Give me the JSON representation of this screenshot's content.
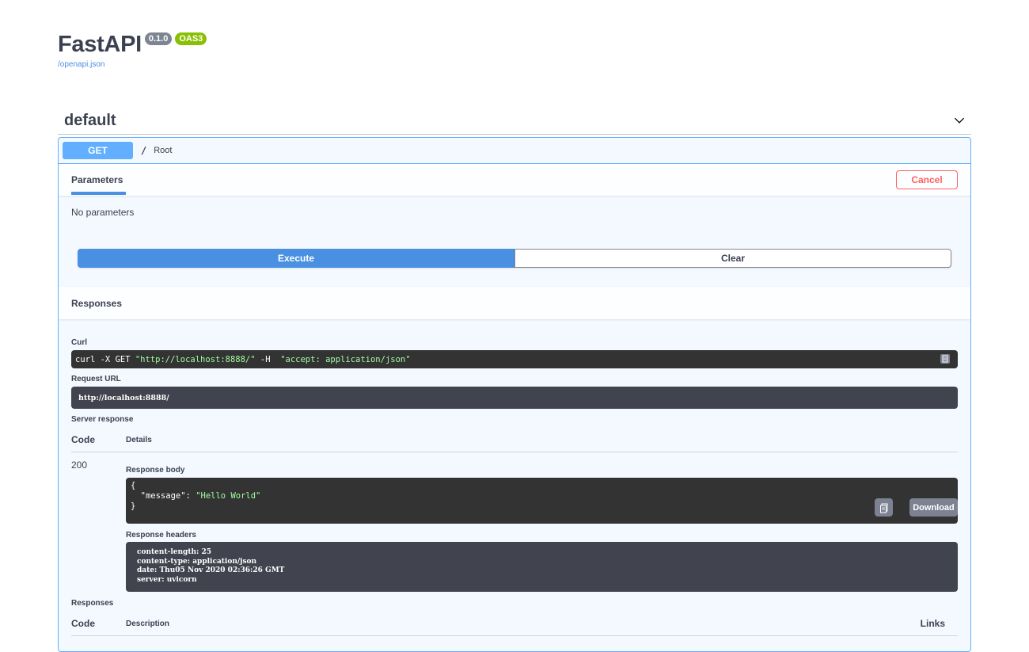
{
  "info": {
    "title": "FastAPI",
    "version": "0.1.0",
    "oas_badge": "OAS3",
    "spec_link": "/openapi.json"
  },
  "tag": {
    "name": "default",
    "toggle_icon": "chevron-down-icon"
  },
  "operation": {
    "method": "GET",
    "path": "/",
    "summary": "Root",
    "parameters_tab": "Parameters",
    "cancel_label": "Cancel",
    "no_params": "No parameters",
    "execute_label": "Execute",
    "clear_label": "Clear",
    "responses_title": "Responses",
    "curl_label": "Curl",
    "curl": {
      "prefix": "curl -X GET ",
      "url": "\"http://localhost:8888/\"",
      "flag": " -H  ",
      "header": "\"accept: application/json\""
    },
    "request_url_label": "Request URL",
    "request_url": "http://localhost:8888/",
    "server_response_label": "Server response",
    "server_table": {
      "code_header": "Code",
      "details_header": "Details"
    },
    "status_code": "200",
    "response_body_label": "Response body",
    "response_body": {
      "open": "{",
      "key": "  \"message\"",
      "colon": ": ",
      "value": "\"Hello World\"",
      "close": "}"
    },
    "download_label": "Download",
    "response_headers_label": "Response headers",
    "response_headers": [
      "content-length: 25",
      "content-type: application/json",
      "date: Thu05 Nov 2020 02:36:26 GMT",
      "server: uvicorn"
    ],
    "responses_label": "Responses",
    "responses_table": {
      "code_header": "Code",
      "description_header": "Description",
      "links_header": "Links"
    }
  },
  "colors": {
    "get_method": "#61affe",
    "execute": "#4990e2",
    "cancel": "#ff6060",
    "oas_badge": "#89bf04",
    "version_badge": "#7d8492"
  }
}
